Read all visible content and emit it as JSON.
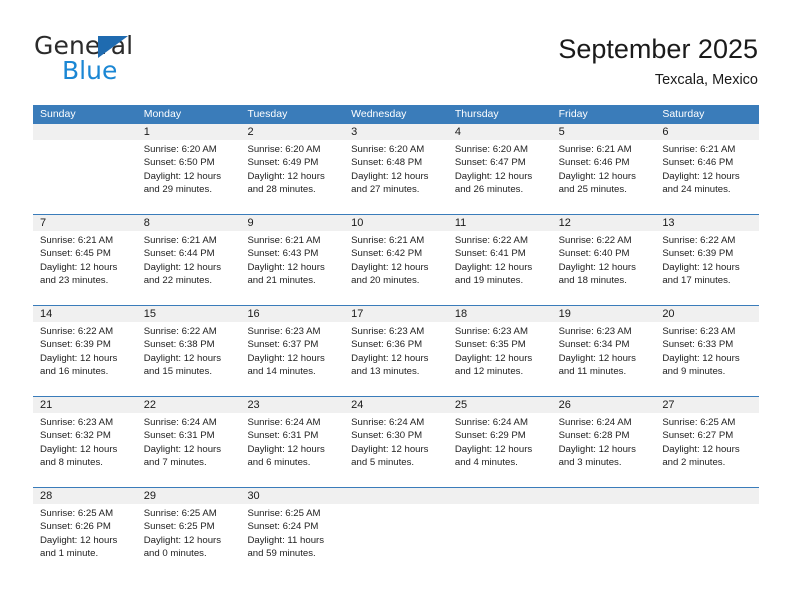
{
  "brand": {
    "name_part1": "General",
    "name_part2": "Blue",
    "triangle_color": "#1f6bb0",
    "blue_text_color": "#1b87d4"
  },
  "header": {
    "title": "September 2025",
    "subtitle": "Texcala, Mexico"
  },
  "theme": {
    "header_row_bg": "#3a7cba",
    "daynum_band_bg": "#f0f0f0",
    "week_divider": "#3a7cba",
    "text": "#1a1a1a"
  },
  "weekdays": [
    "Sunday",
    "Monday",
    "Tuesday",
    "Wednesday",
    "Thursday",
    "Friday",
    "Saturday"
  ],
  "weeks": [
    [
      {
        "day": "",
        "l1": "",
        "l2": "",
        "l3": "",
        "l4": ""
      },
      {
        "day": "1",
        "l1": "Sunrise: 6:20 AM",
        "l2": "Sunset: 6:50 PM",
        "l3": "Daylight: 12 hours",
        "l4": "and 29 minutes."
      },
      {
        "day": "2",
        "l1": "Sunrise: 6:20 AM",
        "l2": "Sunset: 6:49 PM",
        "l3": "Daylight: 12 hours",
        "l4": "and 28 minutes."
      },
      {
        "day": "3",
        "l1": "Sunrise: 6:20 AM",
        "l2": "Sunset: 6:48 PM",
        "l3": "Daylight: 12 hours",
        "l4": "and 27 minutes."
      },
      {
        "day": "4",
        "l1": "Sunrise: 6:20 AM",
        "l2": "Sunset: 6:47 PM",
        "l3": "Daylight: 12 hours",
        "l4": "and 26 minutes."
      },
      {
        "day": "5",
        "l1": "Sunrise: 6:21 AM",
        "l2": "Sunset: 6:46 PM",
        "l3": "Daylight: 12 hours",
        "l4": "and 25 minutes."
      },
      {
        "day": "6",
        "l1": "Sunrise: 6:21 AM",
        "l2": "Sunset: 6:46 PM",
        "l3": "Daylight: 12 hours",
        "l4": "and 24 minutes."
      }
    ],
    [
      {
        "day": "7",
        "l1": "Sunrise: 6:21 AM",
        "l2": "Sunset: 6:45 PM",
        "l3": "Daylight: 12 hours",
        "l4": "and 23 minutes."
      },
      {
        "day": "8",
        "l1": "Sunrise: 6:21 AM",
        "l2": "Sunset: 6:44 PM",
        "l3": "Daylight: 12 hours",
        "l4": "and 22 minutes."
      },
      {
        "day": "9",
        "l1": "Sunrise: 6:21 AM",
        "l2": "Sunset: 6:43 PM",
        "l3": "Daylight: 12 hours",
        "l4": "and 21 minutes."
      },
      {
        "day": "10",
        "l1": "Sunrise: 6:21 AM",
        "l2": "Sunset: 6:42 PM",
        "l3": "Daylight: 12 hours",
        "l4": "and 20 minutes."
      },
      {
        "day": "11",
        "l1": "Sunrise: 6:22 AM",
        "l2": "Sunset: 6:41 PM",
        "l3": "Daylight: 12 hours",
        "l4": "and 19 minutes."
      },
      {
        "day": "12",
        "l1": "Sunrise: 6:22 AM",
        "l2": "Sunset: 6:40 PM",
        "l3": "Daylight: 12 hours",
        "l4": "and 18 minutes."
      },
      {
        "day": "13",
        "l1": "Sunrise: 6:22 AM",
        "l2": "Sunset: 6:39 PM",
        "l3": "Daylight: 12 hours",
        "l4": "and 17 minutes."
      }
    ],
    [
      {
        "day": "14",
        "l1": "Sunrise: 6:22 AM",
        "l2": "Sunset: 6:39 PM",
        "l3": "Daylight: 12 hours",
        "l4": "and 16 minutes."
      },
      {
        "day": "15",
        "l1": "Sunrise: 6:22 AM",
        "l2": "Sunset: 6:38 PM",
        "l3": "Daylight: 12 hours",
        "l4": "and 15 minutes."
      },
      {
        "day": "16",
        "l1": "Sunrise: 6:23 AM",
        "l2": "Sunset: 6:37 PM",
        "l3": "Daylight: 12 hours",
        "l4": "and 14 minutes."
      },
      {
        "day": "17",
        "l1": "Sunrise: 6:23 AM",
        "l2": "Sunset: 6:36 PM",
        "l3": "Daylight: 12 hours",
        "l4": "and 13 minutes."
      },
      {
        "day": "18",
        "l1": "Sunrise: 6:23 AM",
        "l2": "Sunset: 6:35 PM",
        "l3": "Daylight: 12 hours",
        "l4": "and 12 minutes."
      },
      {
        "day": "19",
        "l1": "Sunrise: 6:23 AM",
        "l2": "Sunset: 6:34 PM",
        "l3": "Daylight: 12 hours",
        "l4": "and 11 minutes."
      },
      {
        "day": "20",
        "l1": "Sunrise: 6:23 AM",
        "l2": "Sunset: 6:33 PM",
        "l3": "Daylight: 12 hours",
        "l4": "and 9 minutes."
      }
    ],
    [
      {
        "day": "21",
        "l1": "Sunrise: 6:23 AM",
        "l2": "Sunset: 6:32 PM",
        "l3": "Daylight: 12 hours",
        "l4": "and 8 minutes."
      },
      {
        "day": "22",
        "l1": "Sunrise: 6:24 AM",
        "l2": "Sunset: 6:31 PM",
        "l3": "Daylight: 12 hours",
        "l4": "and 7 minutes."
      },
      {
        "day": "23",
        "l1": "Sunrise: 6:24 AM",
        "l2": "Sunset: 6:31 PM",
        "l3": "Daylight: 12 hours",
        "l4": "and 6 minutes."
      },
      {
        "day": "24",
        "l1": "Sunrise: 6:24 AM",
        "l2": "Sunset: 6:30 PM",
        "l3": "Daylight: 12 hours",
        "l4": "and 5 minutes."
      },
      {
        "day": "25",
        "l1": "Sunrise: 6:24 AM",
        "l2": "Sunset: 6:29 PM",
        "l3": "Daylight: 12 hours",
        "l4": "and 4 minutes."
      },
      {
        "day": "26",
        "l1": "Sunrise: 6:24 AM",
        "l2": "Sunset: 6:28 PM",
        "l3": "Daylight: 12 hours",
        "l4": "and 3 minutes."
      },
      {
        "day": "27",
        "l1": "Sunrise: 6:25 AM",
        "l2": "Sunset: 6:27 PM",
        "l3": "Daylight: 12 hours",
        "l4": "and 2 minutes."
      }
    ],
    [
      {
        "day": "28",
        "l1": "Sunrise: 6:25 AM",
        "l2": "Sunset: 6:26 PM",
        "l3": "Daylight: 12 hours",
        "l4": "and 1 minute."
      },
      {
        "day": "29",
        "l1": "Sunrise: 6:25 AM",
        "l2": "Sunset: 6:25 PM",
        "l3": "Daylight: 12 hours",
        "l4": "and 0 minutes."
      },
      {
        "day": "30",
        "l1": "Sunrise: 6:25 AM",
        "l2": "Sunset: 6:24 PM",
        "l3": "Daylight: 11 hours",
        "l4": "and 59 minutes."
      },
      {
        "day": "",
        "l1": "",
        "l2": "",
        "l3": "",
        "l4": ""
      },
      {
        "day": "",
        "l1": "",
        "l2": "",
        "l3": "",
        "l4": ""
      },
      {
        "day": "",
        "l1": "",
        "l2": "",
        "l3": "",
        "l4": ""
      },
      {
        "day": "",
        "l1": "",
        "l2": "",
        "l3": "",
        "l4": ""
      }
    ]
  ]
}
